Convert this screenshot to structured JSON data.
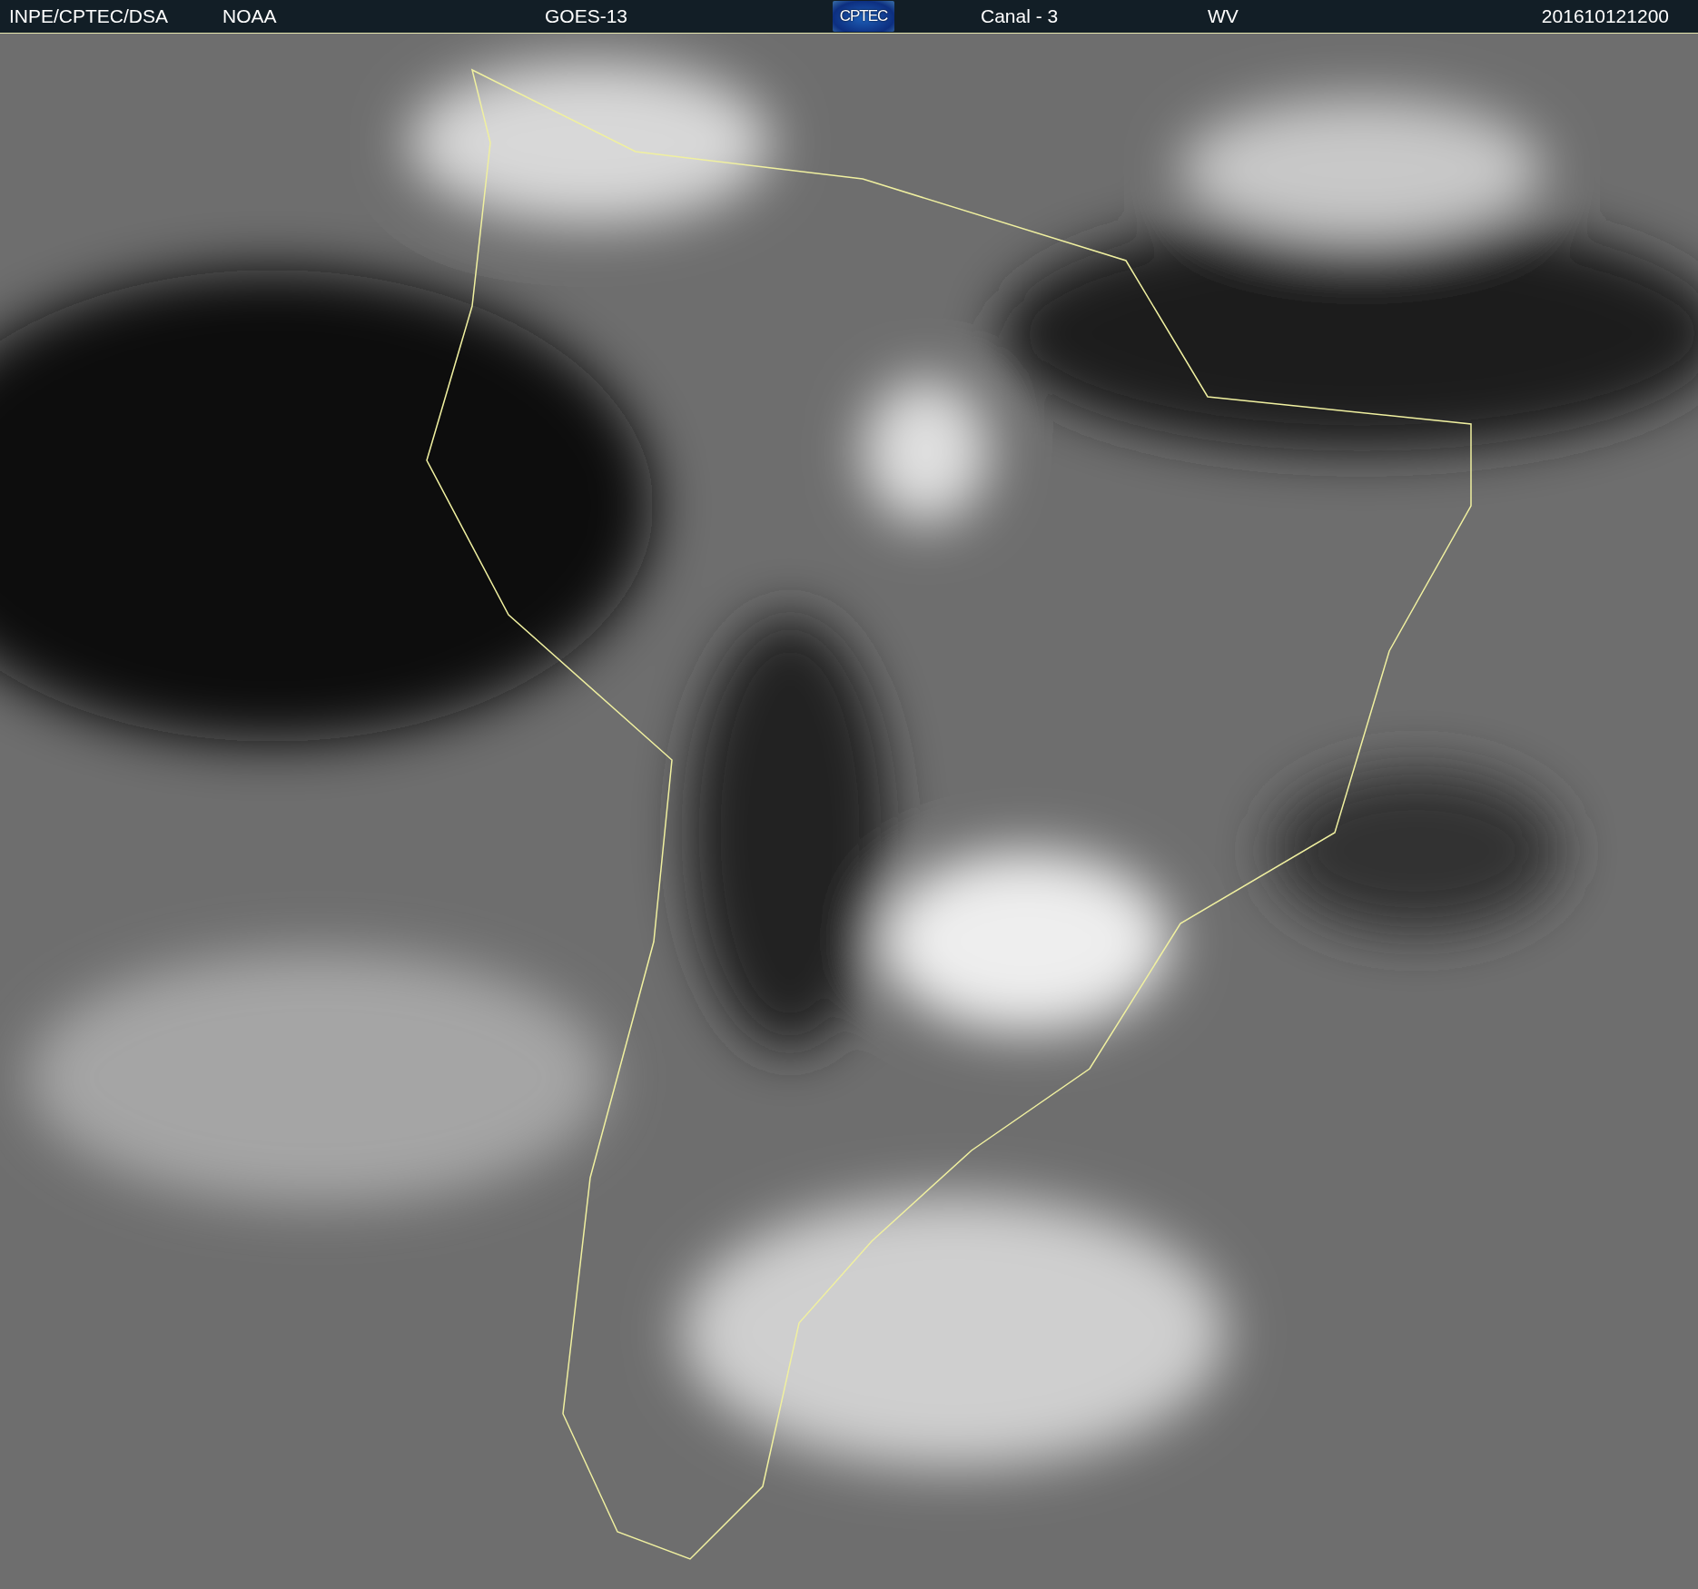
{
  "header": {
    "items": [
      "INPE/CPTEC/DSA",
      "NOAA",
      "GOES-13"
    ],
    "logo": "CPTEC",
    "items_after": [
      "Canal - 3",
      "WV"
    ],
    "timestamp": "201610121200"
  }
}
